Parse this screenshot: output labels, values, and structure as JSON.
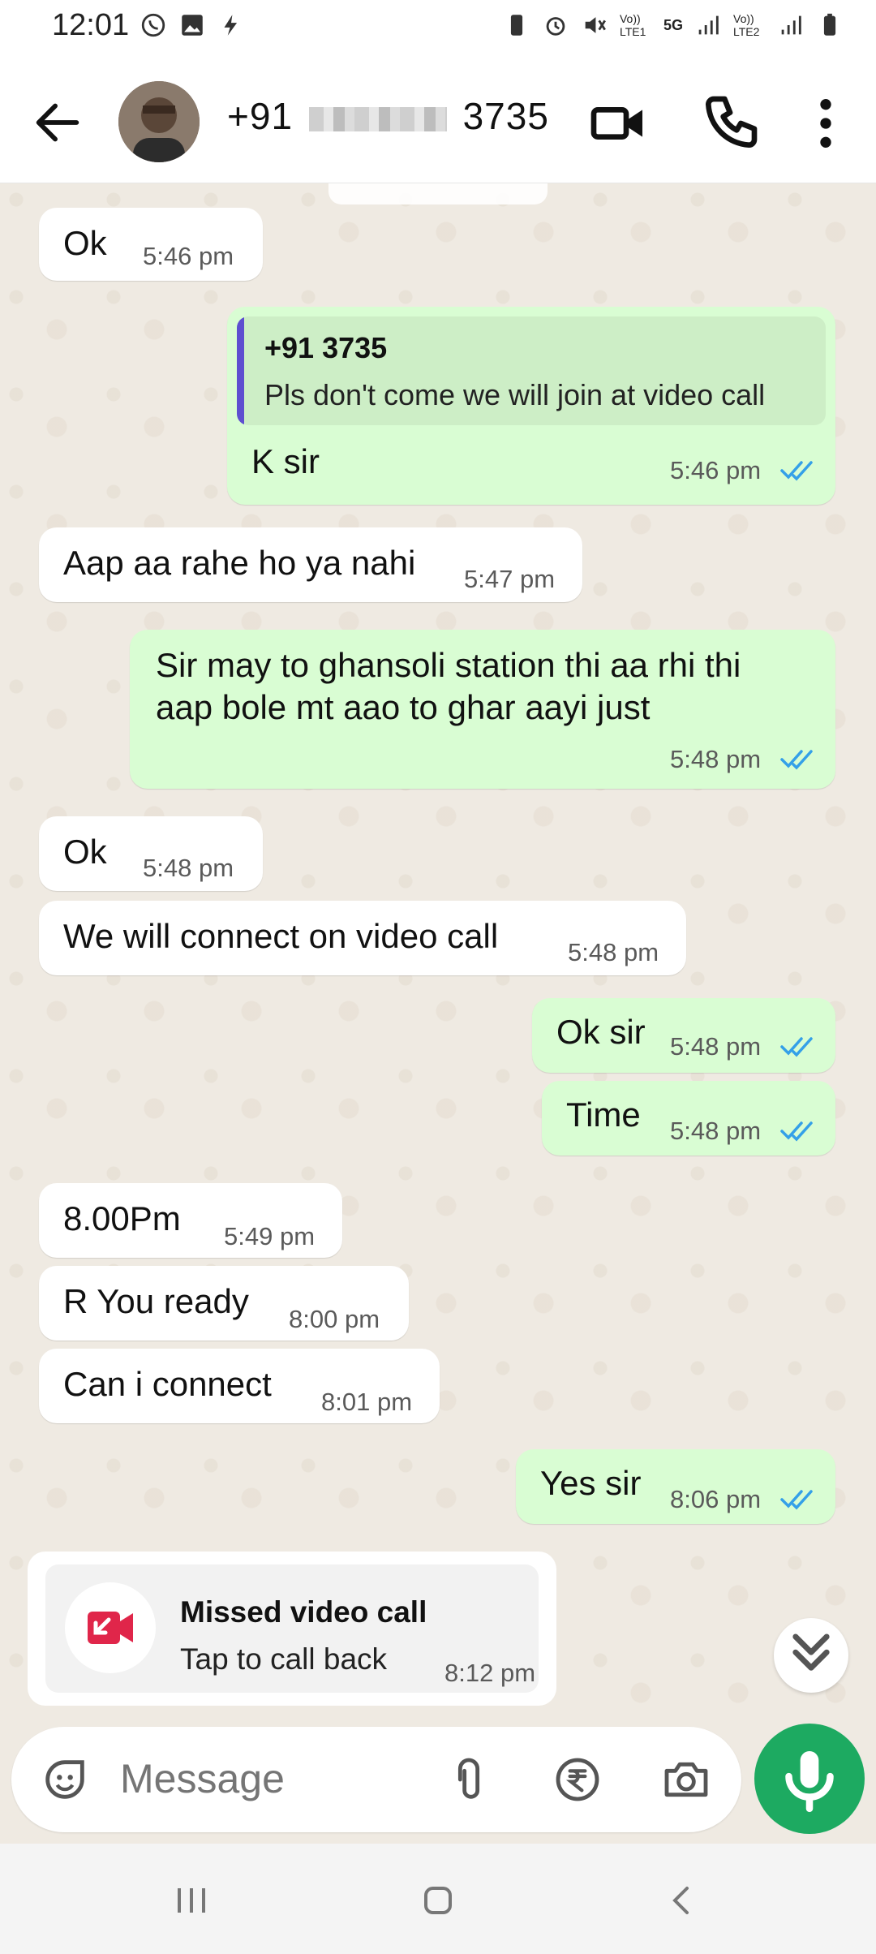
{
  "status_bar": {
    "time": "12:01",
    "network1": "Vo)) LTE1",
    "network2": "5G",
    "network3": "Vo)) LTE2"
  },
  "header": {
    "contact_prefix": "+91",
    "contact_suffix": "3735"
  },
  "messages": [
    {
      "id": "m1",
      "direction": "in",
      "text": "Ok",
      "time": "5:46 pm"
    },
    {
      "id": "m2",
      "direction": "out",
      "quote_name": "+91 3735",
      "quote_text": "Pls don't come we will join at video call",
      "text": "K sir",
      "time": "5:46 pm"
    },
    {
      "id": "m3",
      "direction": "in",
      "text": "Aap aa rahe ho ya nahi",
      "time": "5:47 pm"
    },
    {
      "id": "m4",
      "direction": "out",
      "text_line1": "Sir may to ghansoli station thi aa rhi thi",
      "text_line2": "aap bole mt aao to ghar aayi just",
      "time": "5:48 pm"
    },
    {
      "id": "m5",
      "direction": "in",
      "text": "Ok",
      "time": "5:48 pm"
    },
    {
      "id": "m6",
      "direction": "in",
      "text": "We will connect on video call",
      "time": "5:48 pm"
    },
    {
      "id": "m7",
      "direction": "out",
      "text": "Ok sir",
      "time": "5:48 pm"
    },
    {
      "id": "m8",
      "direction": "out",
      "text": "Time",
      "time": "5:48 pm"
    },
    {
      "id": "m9",
      "direction": "in",
      "text": "8.00Pm",
      "time": "5:49 pm"
    },
    {
      "id": "m10",
      "direction": "in",
      "text": "R You ready",
      "time": "8:00 pm"
    },
    {
      "id": "m11",
      "direction": "in",
      "text": "Can i connect",
      "time": "8:01 pm"
    },
    {
      "id": "m12",
      "direction": "out",
      "text": "Yes sir",
      "time": "8:06 pm"
    }
  ],
  "missed_call": {
    "title": "Missed video call",
    "subtitle": "Tap to call back",
    "time": "8:12 pm"
  },
  "composer": {
    "placeholder": "Message"
  },
  "colors": {
    "outgoing_bubble": "#d9fdd3",
    "incoming_bubble": "#ffffff",
    "read_ticks": "#34a0e8",
    "mic_button": "#1daa61",
    "missed_call_icon": "#e0264a",
    "quote_bar": "#5e4fd0"
  },
  "icons": [
    "back-arrow-icon",
    "video-call-icon",
    "phone-icon",
    "more-vert-icon",
    "sticker-icon",
    "attach-icon",
    "rupee-icon",
    "camera-icon",
    "mic-icon",
    "double-chevron-down-icon",
    "missed-video-call-icon",
    "recent-apps-icon",
    "home-icon",
    "nav-back-icon"
  ]
}
